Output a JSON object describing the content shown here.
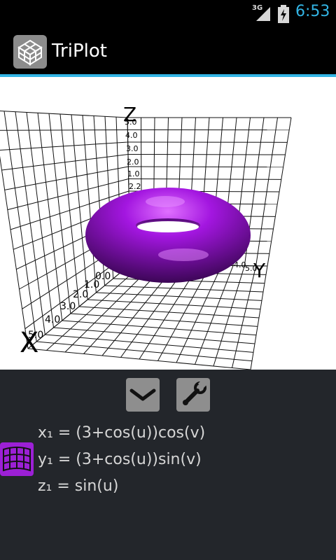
{
  "status_bar": {
    "network": "3G",
    "time": "6:53"
  },
  "app": {
    "title": "TriPlot"
  },
  "plot": {
    "axes": {
      "x": "X",
      "y": "Y",
      "z": "Z"
    },
    "x_ticks": [
      "5.0",
      "4.0",
      "3.0",
      "2.0",
      "1.0",
      "0.0"
    ],
    "y_ticks": [
      "4.0",
      "5.0"
    ],
    "z_ticks": [
      "5.0",
      "4.0",
      "3.0",
      "2.0",
      "1.0",
      "2.2"
    ],
    "surface_color": "#9a12d8"
  },
  "equations": {
    "x": "x₁ = (3+cos(u))cos(v)",
    "y": "y₁ = (3+cos(u))sin(v)",
    "z": "z₁ = sin(u)"
  },
  "colors": {
    "accent": "#33b5e5",
    "panel": "#23262b",
    "mesh_button": "#9c20d6"
  }
}
